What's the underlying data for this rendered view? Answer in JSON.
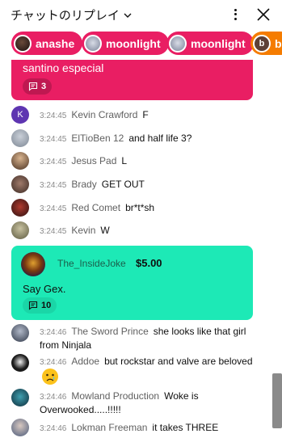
{
  "header": {
    "title": "チャットのリプレイ",
    "dropdown_icon": "chevron-down-icon",
    "more_icon": "more-vert-icon",
    "close_icon": "close-icon"
  },
  "pills": [
    {
      "name": "anashe",
      "color": "#e91e63"
    },
    {
      "name": "moonlight",
      "color": "#e91e63"
    },
    {
      "name": "moonlight",
      "color": "#e91e63"
    },
    {
      "name": "bl",
      "color": "#f57c00"
    }
  ],
  "pinned_pink": {
    "text": "santino especial",
    "reply_count": "3",
    "color": "#e91e63"
  },
  "messages": [
    {
      "time": "3:24:45",
      "author": "Kevin Crawford",
      "text": "F"
    },
    {
      "time": "3:24:45",
      "author": "ElTioBen 12",
      "text": "and half life 3?"
    },
    {
      "time": "3:24:45",
      "author": "Jesus Pad",
      "text": "L"
    },
    {
      "time": "3:24:45",
      "author": "Brady",
      "text": "GET OUT"
    },
    {
      "time": "3:24:45",
      "author": "Red Comet",
      "text": "br*t*sh"
    },
    {
      "time": "3:24:45",
      "author": "Kevin",
      "text": "W"
    }
  ],
  "super_chat": {
    "author": "The_InsideJoke",
    "amount": "$5.00",
    "message": "Say Gex.",
    "reply_count": "10",
    "color": "#1de9b6"
  },
  "messages2": [
    {
      "time": "3:24:46",
      "author": "The Sword Prince",
      "text": "she looks like that girl",
      "text2": "from Ninjala"
    },
    {
      "time": "3:24:46",
      "author": "Addoe",
      "text": "but rockstar and valve are beloved",
      "emoji": "crying-face-emoji"
    },
    {
      "time": "3:24:46",
      "author": "Mowland Production",
      "text": "Woke is",
      "text2": "Overwooked.....!!!!!"
    },
    {
      "time": "3:24:46",
      "author": "Lokman Freeman",
      "text": "it takes THREE"
    }
  ]
}
